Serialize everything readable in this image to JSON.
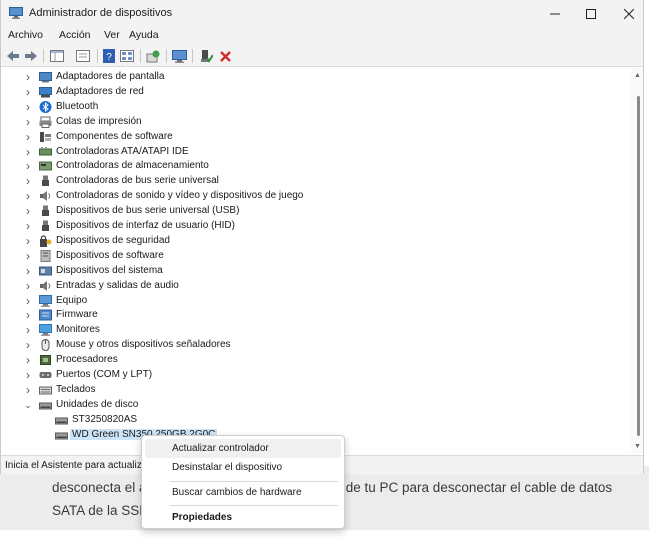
{
  "article": {
    "line1_left": "desconecta el a",
    "line1_right": "or de tu PC para desconectar el cable de datos",
    "line2": "SATA de la SSD"
  },
  "window": {
    "title": "Administrador de dispositivos",
    "menu": [
      "Archivo",
      "Acción",
      "Ver",
      "Ayuda"
    ],
    "status": "Inicia el Asistente para actualiza"
  },
  "tree": {
    "categories": [
      {
        "label": "Adaptadores de pantalla",
        "icon": "display-adapter-icon"
      },
      {
        "label": "Adaptadores de red",
        "icon": "network-adapter-icon"
      },
      {
        "label": "Bluetooth",
        "icon": "bluetooth-icon"
      },
      {
        "label": "Colas de impresión",
        "icon": "print-queue-icon"
      },
      {
        "label": "Componentes de software",
        "icon": "software-component-icon"
      },
      {
        "label": "Controladoras ATA/ATAPI IDE",
        "icon": "ide-controller-icon"
      },
      {
        "label": "Controladoras de almacenamiento",
        "icon": "storage-controller-icon"
      },
      {
        "label": "Controladoras de bus serie universal",
        "icon": "usb-icon"
      },
      {
        "label": "Controladoras de sonido y vídeo y dispositivos de juego",
        "icon": "sound-icon"
      },
      {
        "label": "Dispositivos de bus serie universal (USB)",
        "icon": "usb-device-icon"
      },
      {
        "label": "Dispositivos de interfaz de usuario (HID)",
        "icon": "hid-icon"
      },
      {
        "label": "Dispositivos de seguridad",
        "icon": "security-device-icon"
      },
      {
        "label": "Dispositivos de software",
        "icon": "software-device-icon"
      },
      {
        "label": "Dispositivos del sistema",
        "icon": "system-device-icon"
      },
      {
        "label": "Entradas y salidas de audio",
        "icon": "audio-io-icon"
      },
      {
        "label": "Equipo",
        "icon": "computer-icon"
      },
      {
        "label": "Firmware",
        "icon": "firmware-icon"
      },
      {
        "label": "Monitores",
        "icon": "monitor-icon"
      },
      {
        "label": "Mouse y otros dispositivos señaladores",
        "icon": "mouse-icon"
      },
      {
        "label": "Procesadores",
        "icon": "processor-icon"
      },
      {
        "label": "Puertos (COM y LPT)",
        "icon": "port-icon"
      },
      {
        "label": "Teclados",
        "icon": "keyboard-icon"
      },
      {
        "label": "Unidades de disco",
        "icon": "disk-drive-icon",
        "expanded": true
      }
    ],
    "disk_children": [
      {
        "label": "ST3250820AS",
        "icon": "disk-drive-icon"
      },
      {
        "label": "WD Green SN350 250GB 2G0C",
        "icon": "disk-drive-icon",
        "selected": true
      }
    ]
  },
  "context_menu": {
    "items": [
      {
        "label": "Actualizar controlador",
        "highlighted": true
      },
      {
        "label": "Desinstalar el dispositivo"
      },
      {
        "label": "Buscar cambios de hardware"
      },
      {
        "label": "Propiedades",
        "bold": true
      }
    ]
  },
  "colors": {
    "selection": "#cce4f7",
    "close_red": "#d42a2a",
    "accent_green": "#2e8b3a"
  }
}
